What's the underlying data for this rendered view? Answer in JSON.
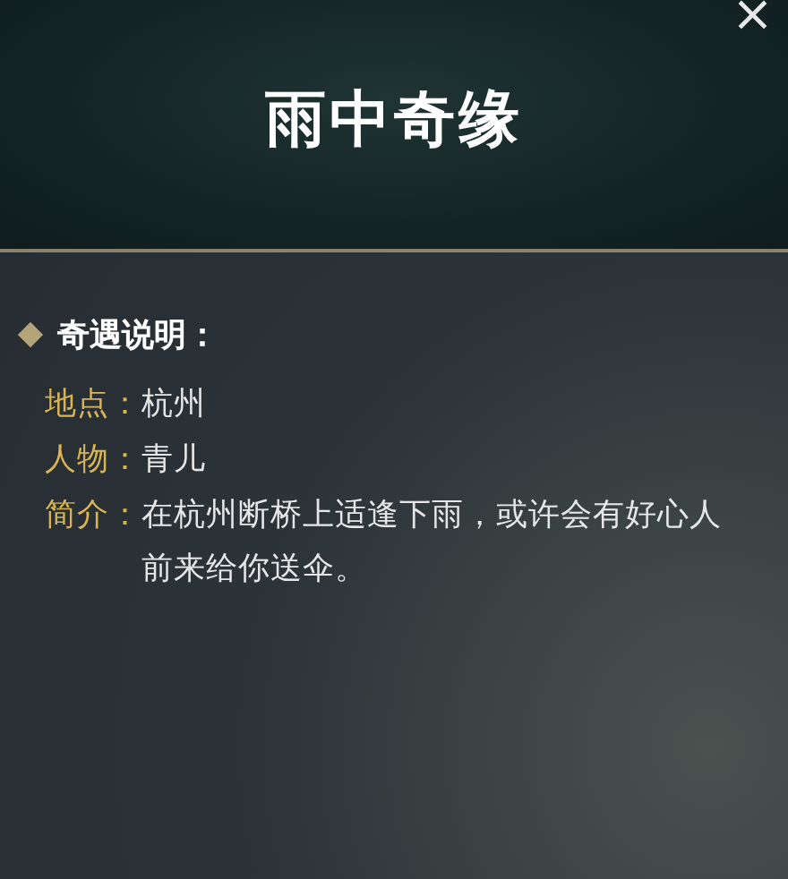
{
  "title": "雨中奇缘",
  "close": "×",
  "section": {
    "heading": "奇遇说明：",
    "fields": [
      {
        "label": "地点：",
        "value": "杭州"
      },
      {
        "label": "人物：",
        "value": "青儿"
      },
      {
        "label": "简介：",
        "value": "在杭州断桥上适逢下雨，或许会有好心人前来给你送伞。"
      }
    ]
  }
}
